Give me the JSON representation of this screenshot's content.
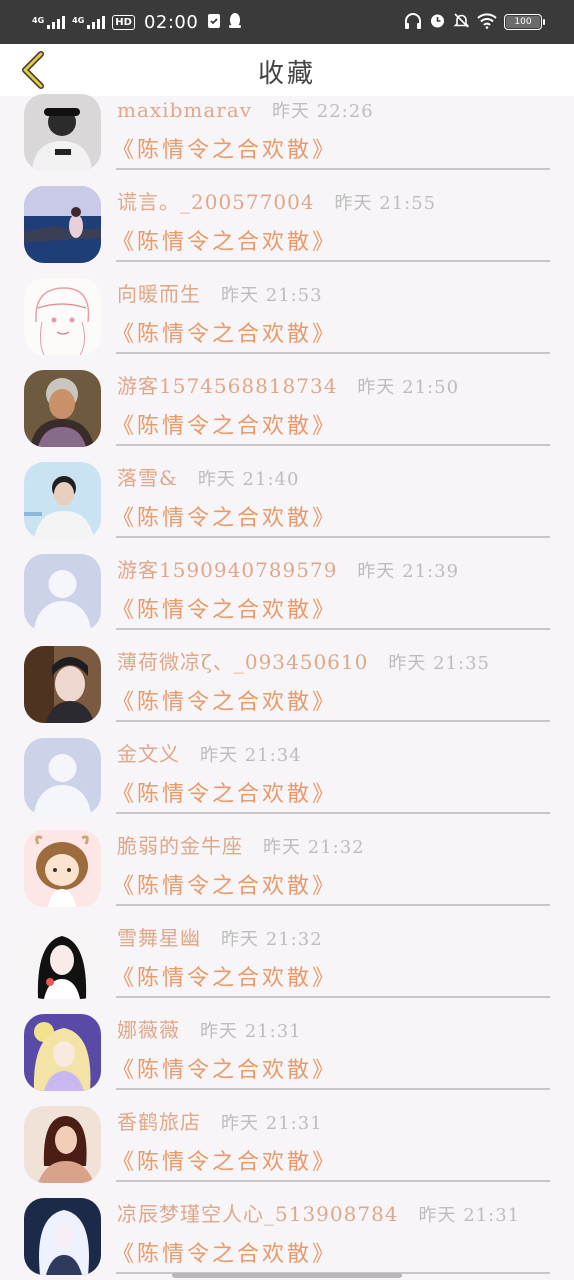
{
  "status": {
    "signal1": "4G",
    "signal2": "4G",
    "hd": "HD",
    "time": "02:00",
    "battery": "100"
  },
  "header": {
    "title": "收藏"
  },
  "list": [
    {
      "name": "maxibmarav",
      "time": "昨天 22:26",
      "song": "《陈情令之合欢散》",
      "avatar": "photo-person"
    },
    {
      "name": "谎言。_200577004",
      "time": "昨天 21:55",
      "song": "《陈情令之合欢散》",
      "avatar": "photo-sea"
    },
    {
      "name": "向暖而生",
      "time": "昨天 21:53",
      "song": "《陈情令之合欢散》",
      "avatar": "sketch-girl"
    },
    {
      "name": "游客1574568818734",
      "time": "昨天 21:50",
      "song": "《陈情令之合欢散》",
      "avatar": "photo-elder"
    },
    {
      "name": "落雪&",
      "time": "昨天 21:40",
      "song": "《陈情令之合欢散》",
      "avatar": "photo-man"
    },
    {
      "name": "游客1590940789579",
      "time": "昨天 21:39",
      "song": "《陈情令之合欢散》",
      "avatar": "default"
    },
    {
      "name": "薄荷微凉ζ、_093450610",
      "time": "昨天 21:35",
      "song": "《陈情令之合欢散》",
      "avatar": "photo-woman"
    },
    {
      "name": "金文义",
      "time": "昨天 21:34",
      "song": "《陈情令之合欢散》",
      "avatar": "default"
    },
    {
      "name": "脆弱的金牛座",
      "time": "昨天 21:32",
      "song": "《陈情令之合欢散》",
      "avatar": "cartoon-taurus"
    },
    {
      "name": "雪舞星幽",
      "time": "昨天 21:32",
      "song": "《陈情令之合欢散》",
      "avatar": "anime-white"
    },
    {
      "name": "娜薇薇",
      "time": "昨天 21:31",
      "song": "《陈情令之合欢散》",
      "avatar": "anime-purple"
    },
    {
      "name": "香鹤旅店",
      "time": "昨天 21:31",
      "song": "《陈情令之合欢散》",
      "avatar": "photo-girl"
    },
    {
      "name": "凉辰梦瑾空人心_513908784",
      "time": "昨天 21:31",
      "song": "《陈情令之合欢散》",
      "avatar": "anime-dark"
    }
  ]
}
